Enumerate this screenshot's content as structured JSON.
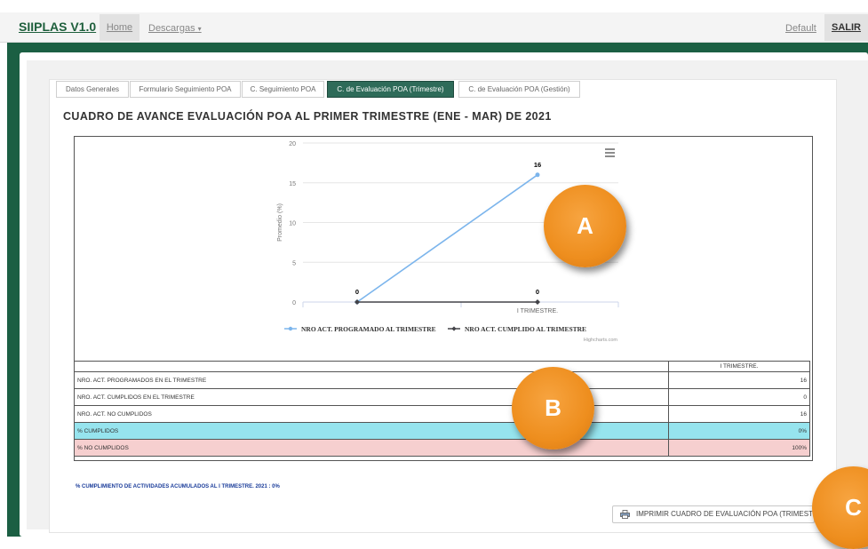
{
  "navbar": {
    "brand": "SIIPLAS V1.0",
    "home": "Home",
    "descargas": "Descargas",
    "default": "Default",
    "salir": "SALIR"
  },
  "tabs": [
    {
      "label": "Datos Generales",
      "active": false
    },
    {
      "label": "Formulario Seguimiento POA",
      "active": false
    },
    {
      "label": "C. Seguimiento POA",
      "active": false
    },
    {
      "label": "C. de Evaluación POA (Trimestre)",
      "active": true
    },
    {
      "label": "C. de Evaluación POA (Gestión)",
      "active": false
    }
  ],
  "page_title": "CUADRO DE AVANCE EVALUACIÓN POA AL PRIMER TRIMESTRE (ENE - MAR) DE 2021",
  "chart_data": {
    "type": "line",
    "ylabel": "Promedio (%)",
    "ylim": [
      0,
      20
    ],
    "yticks": [
      "0",
      "5",
      "10",
      "15",
      "20"
    ],
    "categories": [
      "",
      "I TRIMESTRE."
    ],
    "series": [
      {
        "name": "NRO ACT. PROGRAMADO AL TRIMESTRE",
        "values": [
          0,
          16
        ],
        "color": "#7cb5ec"
      },
      {
        "name": "NRO ACT. CUMPLIDO AL TRIMESTRE",
        "values": [
          0,
          0
        ],
        "color": "#434348"
      }
    ],
    "data_labels": [
      "0",
      "16",
      "0"
    ],
    "credits": "Highcharts.com",
    "legend_position": "bottom"
  },
  "table": {
    "header": "I TRIMESTRE.",
    "rows": [
      {
        "label": "NRO. ACT. PROGRAMADOS EN EL TRIMESTRE",
        "value": "16",
        "style": "plain"
      },
      {
        "label": "NRO. ACT. CUMPLIDOS EN EL TRIMESTRE",
        "value": "0",
        "style": "plain"
      },
      {
        "label": "NRO. ACT. NO CUMPLIDOS",
        "value": "16",
        "style": "plain"
      },
      {
        "label": "% CUMPLIDOS",
        "value": "0%",
        "style": "cyan"
      },
      {
        "label": "% NO CUMPLIDOS",
        "value": "100%",
        "style": "pink"
      }
    ]
  },
  "footnote": "% CUMPLIMIENTO DE ACTIVIDADES ACUMULADOS AL I TRIMESTRE. 2021 : 0%",
  "print_button": "IMPRIMIR CUADRO DE EVALUACIÓN POA (TRIMESTRAL)",
  "callouts": [
    "A",
    "B",
    "C"
  ],
  "colors": {
    "brand_green": "#1b5f43",
    "active_tab": "#2e6b59",
    "callout_orange": "#ee8e1e",
    "cyan_row": "#96e4ee",
    "pink_row": "#f6cfcf",
    "footnote_blue": "#1a3c9a"
  }
}
